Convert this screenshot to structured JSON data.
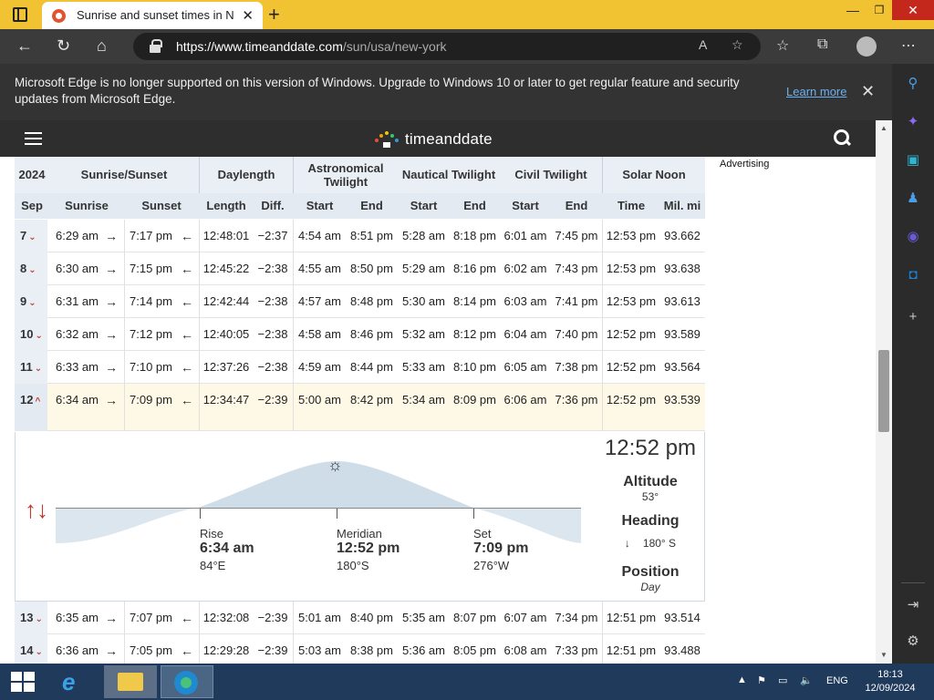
{
  "browser": {
    "tab_title": "Sunrise and sunset times in New York",
    "url_host": "https://www.timeanddate.com",
    "url_path": "/sun/usa/new-york",
    "info_message": "Microsoft Edge is no longer supported on this version of Windows. Upgrade to Windows 10 or later to get regular feature and security updates from Microsoft Edge.",
    "learn_more": "Learn more"
  },
  "site": {
    "logo_text": "timeanddate",
    "advertising": "Advertising"
  },
  "table": {
    "header_row1": {
      "year": "2024",
      "sunrise_sunset": "Sunrise/Sunset",
      "daylength": "Daylength",
      "astronomical": "Astronomical Twilight",
      "nautical": "Nautical Twilight",
      "civil": "Civil Twilight",
      "solar_noon": "Solar Noon"
    },
    "header_row2": {
      "month": "Sep",
      "sunrise": "Sunrise",
      "sunset": "Sunset",
      "length": "Length",
      "diff": "Diff.",
      "astro_start": "Start",
      "astro_end": "End",
      "naut_start": "Start",
      "naut_end": "End",
      "civil_start": "Start",
      "civil_end": "End",
      "noon_time": "Time",
      "noon_dist": "Mil. mi"
    },
    "rows": [
      {
        "day": "7",
        "sunrise": "6:29 am",
        "sunset": "7:17 pm",
        "length": "12:48:01",
        "diff": "−2:37",
        "astro_start": "4:54 am",
        "astro_end": "8:51 pm",
        "naut_start": "5:28 am",
        "naut_end": "8:18 pm",
        "civil_start": "6:01 am",
        "civil_end": "7:45 pm",
        "noon": "12:53 pm",
        "dist": "93.662"
      },
      {
        "day": "8",
        "sunrise": "6:30 am",
        "sunset": "7:15 pm",
        "length": "12:45:22",
        "diff": "−2:38",
        "astro_start": "4:55 am",
        "astro_end": "8:50 pm",
        "naut_start": "5:29 am",
        "naut_end": "8:16 pm",
        "civil_start": "6:02 am",
        "civil_end": "7:43 pm",
        "noon": "12:53 pm",
        "dist": "93.638"
      },
      {
        "day": "9",
        "sunrise": "6:31 am",
        "sunset": "7:14 pm",
        "length": "12:42:44",
        "diff": "−2:38",
        "astro_start": "4:57 am",
        "astro_end": "8:48 pm",
        "naut_start": "5:30 am",
        "naut_end": "8:14 pm",
        "civil_start": "6:03 am",
        "civil_end": "7:41 pm",
        "noon": "12:53 pm",
        "dist": "93.613"
      },
      {
        "day": "10",
        "sunrise": "6:32 am",
        "sunset": "7:12 pm",
        "length": "12:40:05",
        "diff": "−2:38",
        "astro_start": "4:58 am",
        "astro_end": "8:46 pm",
        "naut_start": "5:32 am",
        "naut_end": "8:12 pm",
        "civil_start": "6:04 am",
        "civil_end": "7:40 pm",
        "noon": "12:52 pm",
        "dist": "93.589"
      },
      {
        "day": "11",
        "sunrise": "6:33 am",
        "sunset": "7:10 pm",
        "length": "12:37:26",
        "diff": "−2:38",
        "astro_start": "4:59 am",
        "astro_end": "8:44 pm",
        "naut_start": "5:33 am",
        "naut_end": "8:10 pm",
        "civil_start": "6:05 am",
        "civil_end": "7:38 pm",
        "noon": "12:52 pm",
        "dist": "93.564"
      },
      {
        "day": "12",
        "sunrise": "6:34 am",
        "sunset": "7:09 pm",
        "length": "12:34:47",
        "diff": "−2:39",
        "astro_start": "5:00 am",
        "astro_end": "8:42 pm",
        "naut_start": "5:34 am",
        "naut_end": "8:09 pm",
        "civil_start": "6:06 am",
        "civil_end": "7:36 pm",
        "noon": "12:52 pm",
        "dist": "93.539"
      },
      {
        "day": "13",
        "sunrise": "6:35 am",
        "sunset": "7:07 pm",
        "length": "12:32:08",
        "diff": "−2:39",
        "astro_start": "5:01 am",
        "astro_end": "8:40 pm",
        "naut_start": "5:35 am",
        "naut_end": "8:07 pm",
        "civil_start": "6:07 am",
        "civil_end": "7:34 pm",
        "noon": "12:51 pm",
        "dist": "93.514"
      },
      {
        "day": "14",
        "sunrise": "6:36 am",
        "sunset": "7:05 pm",
        "length": "12:29:28",
        "diff": "−2:39",
        "astro_start": "5:03 am",
        "astro_end": "8:38 pm",
        "naut_start": "5:36 am",
        "naut_end": "8:05 pm",
        "civil_start": "6:08 am",
        "civil_end": "7:33 pm",
        "noon": "12:51 pm",
        "dist": "93.488"
      }
    ]
  },
  "detail": {
    "noon_time": "12:52 pm",
    "rise_label": "Rise",
    "rise_time": "6:34 am",
    "rise_deg": "84°E",
    "meridian_label": "Meridian",
    "meridian_time": "12:52 pm",
    "meridian_deg": "180°S",
    "set_label": "Set",
    "set_time": "7:09 pm",
    "set_deg": "276°W",
    "altitude_label": "Altitude",
    "altitude_value": "53°",
    "heading_label": "Heading",
    "heading_value": "180° S",
    "position_label": "Position",
    "position_value": "Day"
  },
  "taskbar": {
    "lang": "ENG",
    "time": "18:13",
    "date": "12/09/2024"
  }
}
